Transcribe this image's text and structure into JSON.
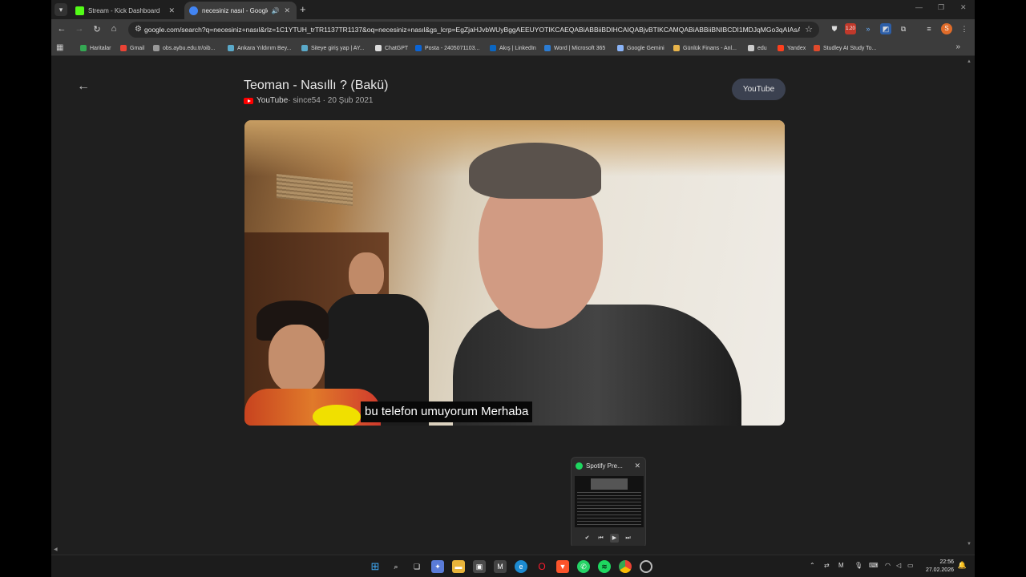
{
  "browser": {
    "tabs": [
      {
        "title": "Stream - Kick Dashboard",
        "favicon_color": "#53fc18",
        "active": false
      },
      {
        "title": "necesiniz nasıl - Google'da",
        "favicon_color": "#4285f4",
        "active": true
      }
    ],
    "url": "google.com/search?q=necesiniz+nasıl&rlz=1C1YTUH_trTR1137TR1137&oq=necesiniz+nasıl&gs_lcrp=EgZjaHJvbWUyBggAEEUYOTIKCAEQABiABBiiBDIHCAIQABjvBTIKCAMQABiABBiiBNIBCDI1MDJqMGo3qAIAsAIA&sourc...",
    "extension_badge": "1.20",
    "profile_initial": "S"
  },
  "bookmarks": [
    {
      "label": "Haritalar",
      "color": "#34a853"
    },
    {
      "label": "Gmail",
      "color": "#ea4335"
    },
    {
      "label": "obs.aybu.edu.tr/oib...",
      "color": "#999999"
    },
    {
      "label": "Ankara Yıldırım Bey...",
      "color": "#5aa9c9"
    },
    {
      "label": "Siteye giriş yap | AY...",
      "color": "#5aa9c9"
    },
    {
      "label": "ChatGPT",
      "color": "#dddddd"
    },
    {
      "label": "Posta - 2405071103...",
      "color": "#0a64d6"
    },
    {
      "label": "Akış | LinkedIn",
      "color": "#0a66c2"
    },
    {
      "label": "Word | Microsoft 365",
      "color": "#2b7cd3"
    },
    {
      "label": "Google Gemini",
      "color": "#8ab4f8"
    },
    {
      "label": "Günlük Finans - Anl...",
      "color": "#e8b44a"
    },
    {
      "label": "edu",
      "color": "#cccccc"
    },
    {
      "label": "Yandex",
      "color": "#fc3f1d"
    },
    {
      "label": "Studley AI Study To...",
      "color": "#e04a2c"
    }
  ],
  "video": {
    "title": "Teoman - Nasıllı ? (Bakü)",
    "source": "YouTube",
    "meta": " · since54 · 20 Şub 2021",
    "open_button": "YouTube",
    "caption": "bu telefon umuyorum Merhaba"
  },
  "spotify_preview": {
    "title": "Spotify Pre...",
    "accent": "#1ed760"
  },
  "taskbar": {
    "time": "22:56",
    "date": "27.02.2026"
  }
}
